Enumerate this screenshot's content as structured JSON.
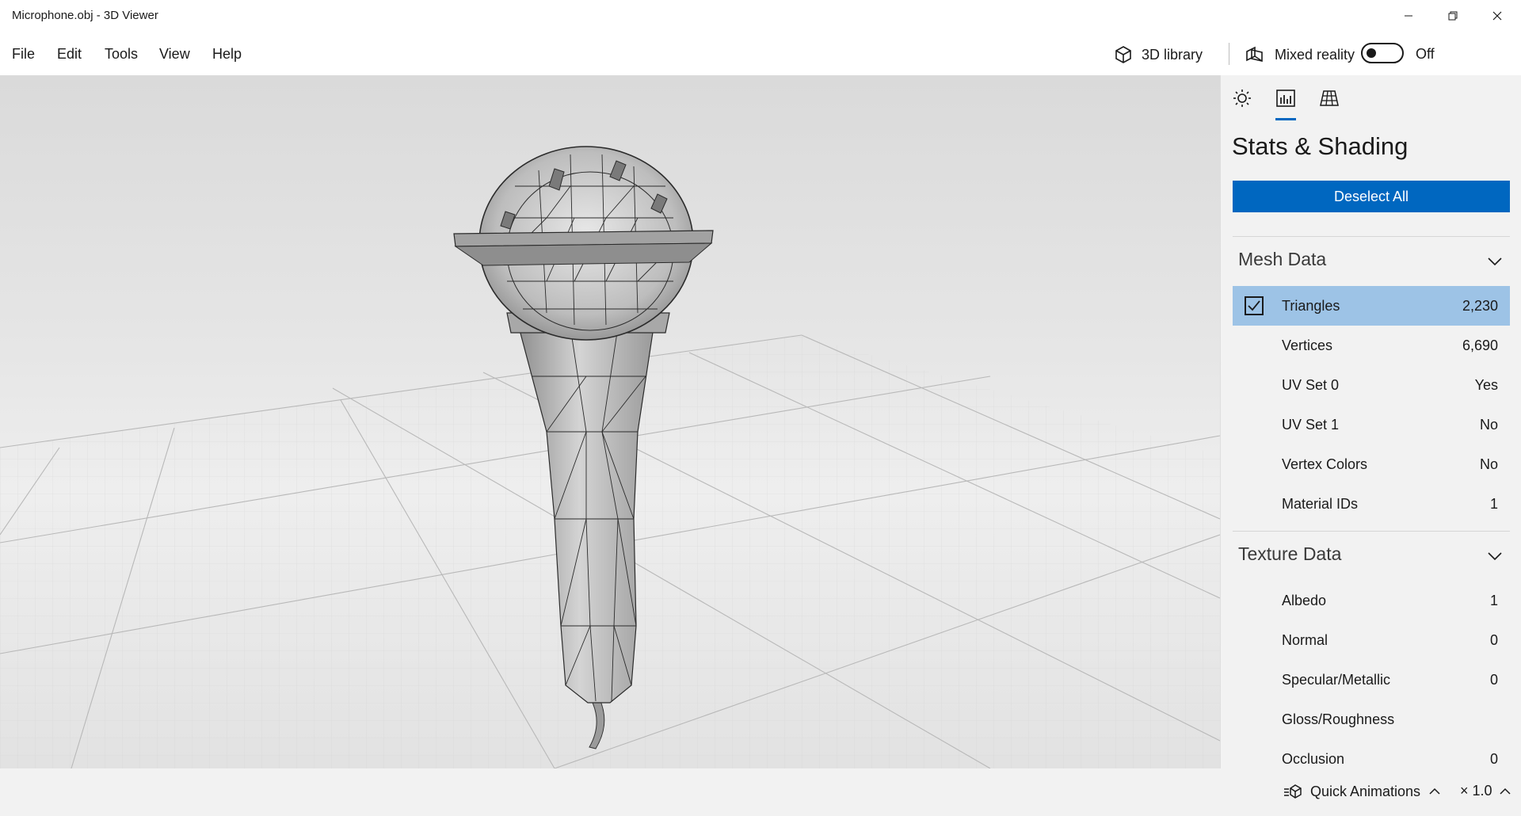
{
  "window": {
    "title": "Microphone.obj - 3D Viewer"
  },
  "menu": {
    "items": [
      "File",
      "Edit",
      "Tools",
      "View",
      "Help"
    ],
    "library_label": "3D library",
    "mixed_reality_label": "Mixed reality",
    "mixed_reality_state": "Off"
  },
  "panel": {
    "title": "Stats & Shading",
    "deselect_label": "Deselect All",
    "mesh_section": "Mesh Data",
    "mesh_rows": [
      {
        "label": "Triangles",
        "value": "2,230",
        "checked": true
      },
      {
        "label": "Vertices",
        "value": "6,690"
      },
      {
        "label": "UV Set 0",
        "value": "Yes"
      },
      {
        "label": "UV Set 1",
        "value": "No"
      },
      {
        "label": "Vertex Colors",
        "value": "No"
      },
      {
        "label": "Material IDs",
        "value": "1"
      }
    ],
    "texture_section": "Texture Data",
    "texture_rows": [
      {
        "label": "Albedo",
        "value": "1"
      },
      {
        "label": "Normal",
        "value": "0"
      },
      {
        "label": "Specular/Metallic",
        "value": "0"
      },
      {
        "label": "Gloss/Roughness",
        "value": ""
      },
      {
        "label": "Occlusion",
        "value": "0"
      }
    ],
    "accent_color": "#0067c0",
    "selected_row_color": "#9dc3e6"
  },
  "status": {
    "animations_label": "Quick Animations",
    "speed_label": "× 1.0"
  }
}
